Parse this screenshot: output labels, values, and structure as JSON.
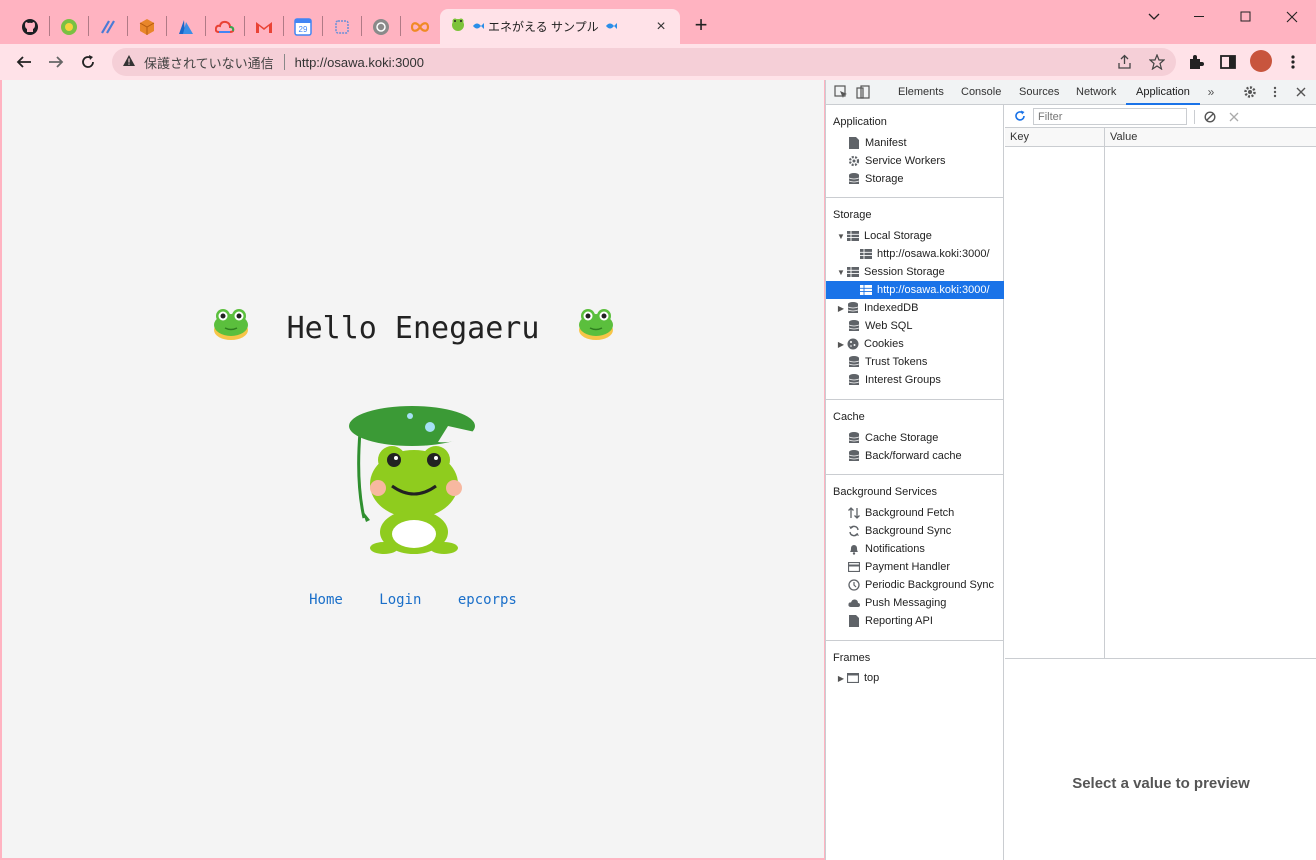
{
  "browser": {
    "active_tab": {
      "title": "エネがえる サンプル"
    },
    "pinned_tabs": [
      "github-icon",
      "circle-logo-icon",
      "slash-logo-icon",
      "box-icon",
      "azure-icon",
      "cloud-icon",
      "gmail-icon",
      "calendar-icon",
      "square-icon",
      "openai-icon",
      "infinity-icon"
    ],
    "address": {
      "security_label": "保護されていない通信",
      "url": "http://osawa.koki:3000"
    }
  },
  "page": {
    "heading": "Hello Enegaeru",
    "links": [
      "Home",
      "Login",
      "epcorps"
    ]
  },
  "devtools": {
    "tabs": [
      "Elements",
      "Console",
      "Sources",
      "Network",
      "Application"
    ],
    "active_tab": "Application",
    "sections": {
      "application": {
        "title": "Application",
        "items": [
          "Manifest",
          "Service Workers",
          "Storage"
        ]
      },
      "storage": {
        "title": "Storage",
        "local_storage": "Local Storage",
        "local_origin": "http://osawa.koki:3000/",
        "session_storage": "Session Storage",
        "session_origin": "http://osawa.koki:3000/",
        "items": [
          "IndexedDB",
          "Web SQL",
          "Cookies",
          "Trust Tokens",
          "Interest Groups"
        ]
      },
      "cache": {
        "title": "Cache",
        "items": [
          "Cache Storage",
          "Back/forward cache"
        ]
      },
      "background": {
        "title": "Background Services",
        "items": [
          "Background Fetch",
          "Background Sync",
          "Notifications",
          "Payment Handler",
          "Periodic Background Sync",
          "Push Messaging",
          "Reporting API"
        ]
      },
      "frames": {
        "title": "Frames",
        "items": [
          "top"
        ]
      }
    },
    "filter_placeholder": "Filter",
    "columns": {
      "key": "Key",
      "value": "Value"
    },
    "preview_message": "Select a value to preview"
  }
}
